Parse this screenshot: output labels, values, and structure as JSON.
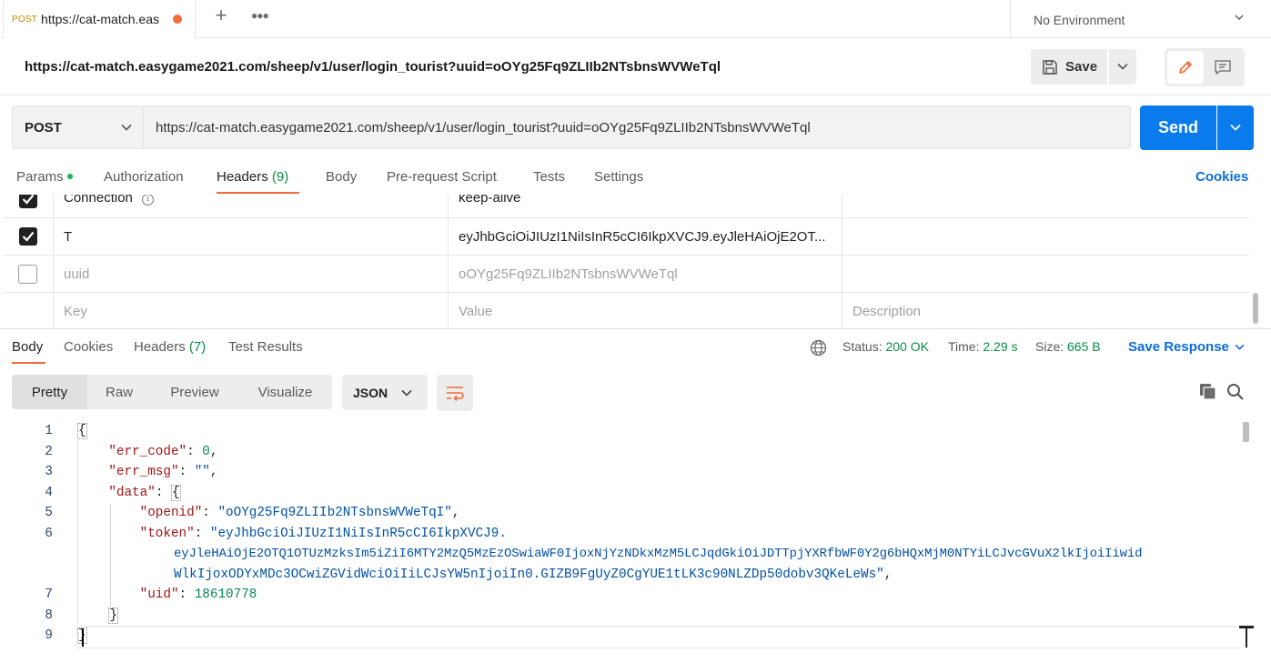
{
  "tab": {
    "method": "POST",
    "title": "https://cat-match.eas"
  },
  "environment": {
    "label": "No Environment"
  },
  "request": {
    "name": "https://cat-match.easygame2021.com/sheep/v1/user/login_tourist?uuid=oOYg25Fq9ZLIIb2NTsbnsWVWeTql",
    "method": "POST",
    "url": "https://cat-match.easygame2021.com/sheep/v1/user/login_tourist?uuid=oOYg25Fq9ZLIIb2NTsbnsWVWeTql"
  },
  "toolbar": {
    "save_label": "Save",
    "send_label": "Send"
  },
  "request_tabs": {
    "params": "Params",
    "authorization": "Authorization",
    "headers": "Headers",
    "headers_count": "(9)",
    "body": "Body",
    "prerequest": "Pre-request Script",
    "tests": "Tests",
    "settings": "Settings",
    "cookies": "Cookies"
  },
  "headers_table": {
    "rows": [
      {
        "key": "Connection",
        "value": "keep-alive",
        "checked": true
      },
      {
        "key": "T",
        "value": "eyJhbGciOiJIUzI1NiIsInR5cCI6IkpXVCJ9.eyJleHAiOjE2OT...",
        "checked": true
      },
      {
        "key": "uuid",
        "value": "oOYg25Fq9ZLIIb2NTsbnsWVWeTql",
        "checked": false
      }
    ],
    "placeholder": {
      "key": "Key",
      "value": "Value",
      "description": "Description"
    }
  },
  "response_tabs": {
    "body": "Body",
    "cookies": "Cookies",
    "headers": "Headers",
    "headers_count": "(7)",
    "test_results": "Test Results"
  },
  "status": {
    "status_label": "Status:",
    "status_value": "200 OK",
    "time_label": "Time:",
    "time_value": "2.29 s",
    "size_label": "Size:",
    "size_value": "665 B",
    "save_response": "Save Response"
  },
  "view_modes": {
    "pretty": "Pretty",
    "raw": "Raw",
    "preview": "Preview",
    "visualize": "Visualize"
  },
  "format": {
    "selected": "JSON"
  },
  "code": {
    "line_numbers": [
      "1",
      "2",
      "3",
      "4",
      "5",
      "6",
      "7",
      "8",
      "9"
    ],
    "open_brace": "{",
    "close_brace": "}",
    "data_open": "{",
    "data_close": "}",
    "k_err_code": "\"err_code\"",
    "v_err_code": "0",
    "k_err_msg": "\"err_msg\"",
    "v_err_msg": "\"\"",
    "k_data": "\"data\"",
    "k_openid": "\"openid\"",
    "v_openid": "\"oOYg25Fq9ZLIIb2NTsbnsWVWeTqI\"",
    "k_token": "\"token\"",
    "v_token_1": "\"eyJhbGciOiJIUzI1NiIsInR5cCI6IkpXVCJ9.",
    "v_token_2": "eyJleHAiOjE2OTQ1OTUzMzksIm5iZiI6MTY2MzQ5MzEzOSwiaWF0IjoxNjYzNDkxMzM5LCJqdGkiOiJDTTpjYXRfbWF0Y2g6bHQxMjM0NTYiLCJvcGVuX2lkIjoiIiwid",
    "v_token_3": "WlkIjoxODYxMDc3OCwiZGVidWciOiIiLCJsYW5nIjoiIn0.GIZB9FgUyZ0CgYUE1tLK3c90NLZDp50dobv3QKeLeWs\"",
    "k_uid": "\"uid\"",
    "v_uid": "18610778"
  }
}
